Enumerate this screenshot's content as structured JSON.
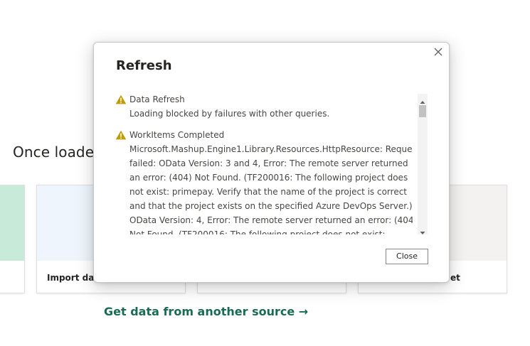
{
  "background": {
    "heading": "Once loaded",
    "cards": [
      {
        "label": ""
      },
      {
        "label": "Import dat"
      },
      {
        "label": ""
      },
      {
        "label": "et"
      }
    ],
    "get_data_link": "Get data from another source →"
  },
  "dialog": {
    "title": "Refresh",
    "close_icon": "close-icon",
    "messages": [
      {
        "icon": "warning-icon",
        "title": "Data Refresh",
        "body": "Loading blocked by failures with other queries."
      },
      {
        "icon": "warning-icon",
        "title": "WorkItems Completed",
        "body": "Microsoft.Mashup.Engine1.Library.Resources.HttpResource: Request failed: OData Version: 3 and 4, Error: The remote server returned an error: (404) Not Found. (TF200016: The following project does not exist: primepay. Verify that the name of the project is correct and that the project exists on the specified Azure DevOps Server.) OData Version: 4, Error: The remote server returned an error: (404) Not Found. (TF200016: The following project does not exist: primepay."
      }
    ],
    "close_button_label": "Close"
  },
  "colors": {
    "warning": "#c19c00",
    "link": "#1a6b55",
    "card_green": "#c8ead9",
    "card_blue": "#eef5fc",
    "card_gray": "#f3f2f1"
  }
}
